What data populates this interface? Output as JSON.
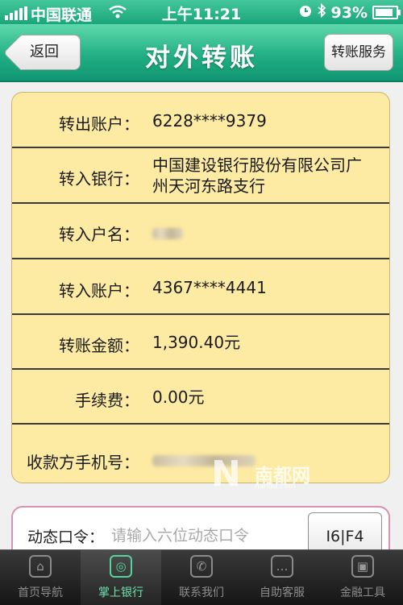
{
  "status_bar": {
    "carrier": "中国联通",
    "time": "上午11:21",
    "battery": "93%"
  },
  "nav": {
    "back_label": "返回",
    "title": "对外转账",
    "service_label": "转账服务"
  },
  "details": [
    {
      "label": "转出账户：",
      "value": "6228****9379"
    },
    {
      "label": "转入银行：",
      "value": "中国建设银行股份有限公司广州天河东路支行"
    },
    {
      "label": "转入户名：",
      "value": ""
    },
    {
      "label": "转入账户：",
      "value": "4367****4441"
    },
    {
      "label": "转账金额：",
      "value": "1,390.40元"
    },
    {
      "label": "手续费：",
      "value": "0.00元"
    },
    {
      "label": "收款方手机号：",
      "value": ""
    }
  ],
  "dynamic_code": {
    "label": "动态口令：",
    "placeholder": "请输入六位动态口令",
    "button_label": "I6|F4"
  },
  "watermark": {
    "text": "南都网",
    "url": "nandu.com"
  },
  "tab_bar": {
    "items": [
      {
        "label": "首页导航",
        "icon": "home-icon"
      },
      {
        "label": "掌上银行",
        "icon": "bank-icon",
        "active": true
      },
      {
        "label": "联系我们",
        "icon": "phone-icon"
      },
      {
        "label": "自助客服",
        "icon": "chat-icon"
      },
      {
        "label": "金融工具",
        "icon": "briefcase-icon"
      }
    ]
  },
  "colors": {
    "header_green": "#22b084",
    "card_yellow": "#fdeaa3",
    "code_border_pink": "#d693b5",
    "tab_active_green": "#53d49c"
  }
}
